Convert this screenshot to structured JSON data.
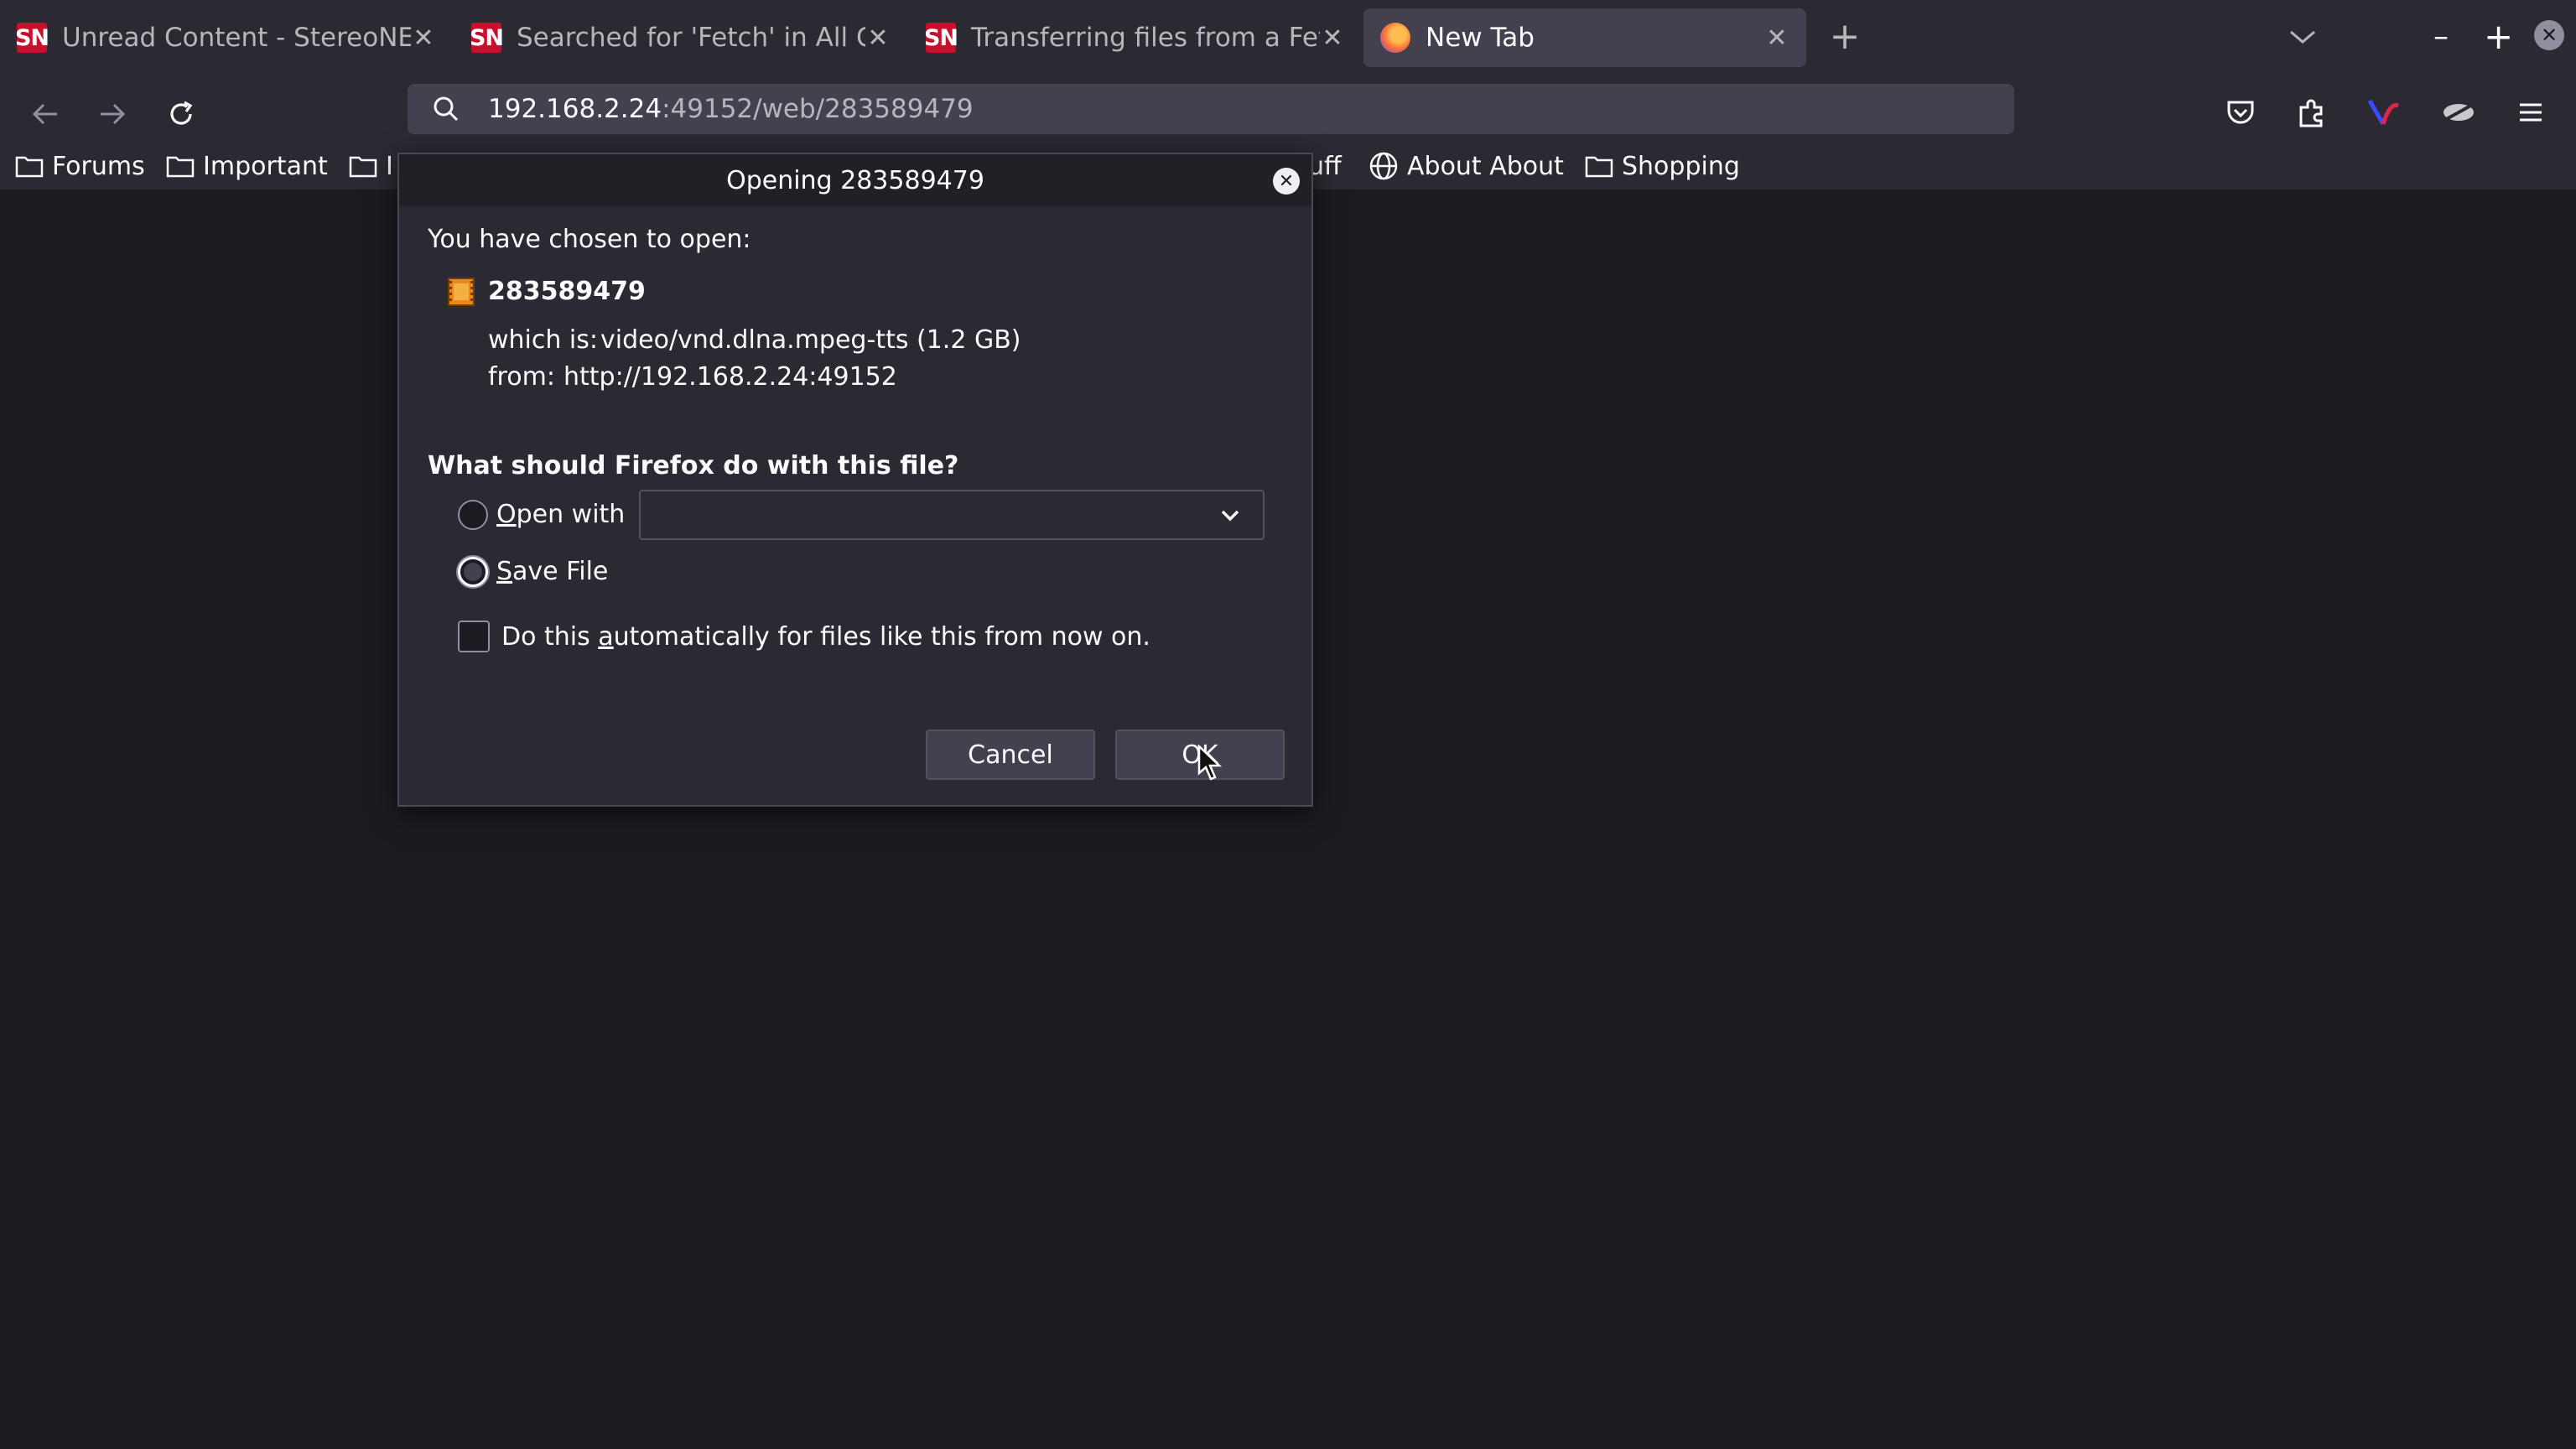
{
  "tabs": [
    {
      "favicon": "SN",
      "title": "Unread Content - StereoNET"
    },
    {
      "favicon": "SN",
      "title": "Searched for 'Fetch' in All Content"
    },
    {
      "favicon": "SN",
      "title": "Transferring files from a Fetch"
    },
    {
      "favicon": "firefox-icon",
      "title": "New Tab"
    }
  ],
  "url": {
    "host": "192.168.2.24",
    "rest": ":49152/web/283589479"
  },
  "bookmarks": [
    {
      "label": "Forums"
    },
    {
      "label": "Important"
    },
    {
      "label": "I"
    },
    {
      "label": "uff"
    },
    {
      "label": "About About"
    },
    {
      "label": "Shopping"
    }
  ],
  "dialog": {
    "title": "Opening 283589479",
    "chosen": "You have chosen to open:",
    "filename": "283589479",
    "which_is_label": "which is:",
    "which_is_value": "video/vnd.dlna.mpeg-tts (1.2 GB)",
    "from_label": "from:",
    "from_value": "http://192.168.2.24:49152",
    "question": "What should Firefox do with this file?",
    "open_with": {
      "key": "O",
      "rest": "pen with"
    },
    "save_file": {
      "key": "S",
      "rest": "ave File"
    },
    "auto": {
      "pre": "Do this ",
      "key": "a",
      "post": "utomatically for files like this from now on."
    },
    "cancel": "Cancel",
    "ok": "OK",
    "selected_option": "save_file",
    "auto_checked": false
  },
  "colors": {
    "accent_sn": "#c8102e",
    "background": "#1c1b22",
    "toolbar": "#2b2a33"
  }
}
